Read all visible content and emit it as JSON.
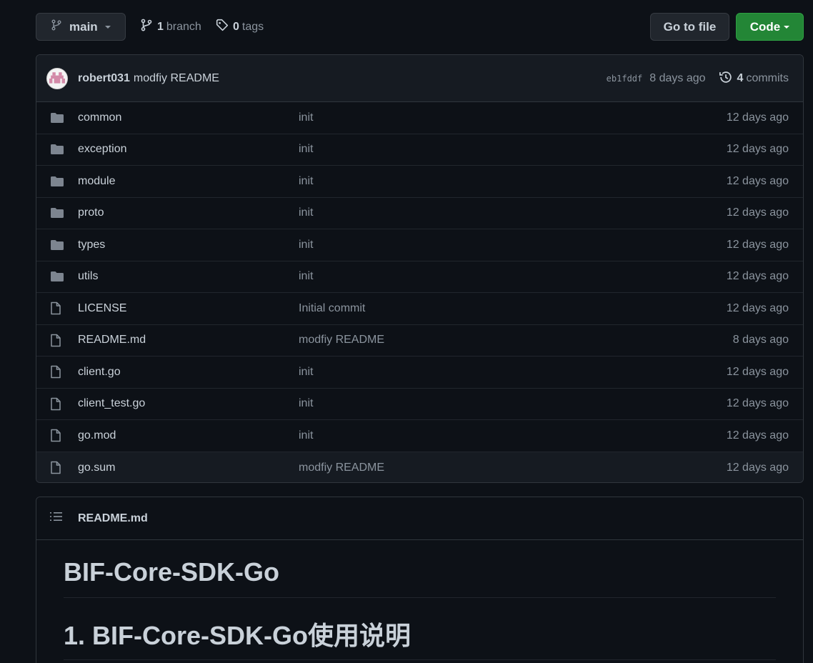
{
  "topbar": {
    "branch": "main",
    "branches_count": "1",
    "branches_label": "branch",
    "tags_count": "0",
    "tags_label": "tags",
    "goto_file": "Go to file",
    "code": "Code"
  },
  "commit": {
    "author": "robert031",
    "message": "modfiy README",
    "sha": "eb1fddf",
    "ago": "8 days ago",
    "commits_count": "4",
    "commits_label": "commits"
  },
  "files": [
    {
      "type": "folder",
      "name": "common",
      "message": "init",
      "age": "12 days ago"
    },
    {
      "type": "folder",
      "name": "exception",
      "message": "init",
      "age": "12 days ago"
    },
    {
      "type": "folder",
      "name": "module",
      "message": "init",
      "age": "12 days ago"
    },
    {
      "type": "folder",
      "name": "proto",
      "message": "init",
      "age": "12 days ago"
    },
    {
      "type": "folder",
      "name": "types",
      "message": "init",
      "age": "12 days ago"
    },
    {
      "type": "folder",
      "name": "utils",
      "message": "init",
      "age": "12 days ago"
    },
    {
      "type": "file",
      "name": "LICENSE",
      "message": "Initial commit",
      "age": "12 days ago"
    },
    {
      "type": "file",
      "name": "README.md",
      "message": "modfiy README",
      "age": "8 days ago"
    },
    {
      "type": "file",
      "name": "client.go",
      "message": "init",
      "age": "12 days ago"
    },
    {
      "type": "file",
      "name": "client_test.go",
      "message": "init",
      "age": "12 days ago"
    },
    {
      "type": "file",
      "name": "go.mod",
      "message": "init",
      "age": "12 days ago"
    },
    {
      "type": "file",
      "name": "go.sum",
      "message": "modfiy README",
      "age": "12 days ago"
    }
  ],
  "readme": {
    "filename": "README.md",
    "h1": "BIF-Core-SDK-Go",
    "h2": "1. BIF-Core-SDK-Go使用说明"
  },
  "colors": {
    "background": "#0d1117",
    "panel": "#161b22",
    "border": "#30363d",
    "code_button": "#238636",
    "muted_text": "#8b949e",
    "folder_icon": "#7d8590"
  }
}
